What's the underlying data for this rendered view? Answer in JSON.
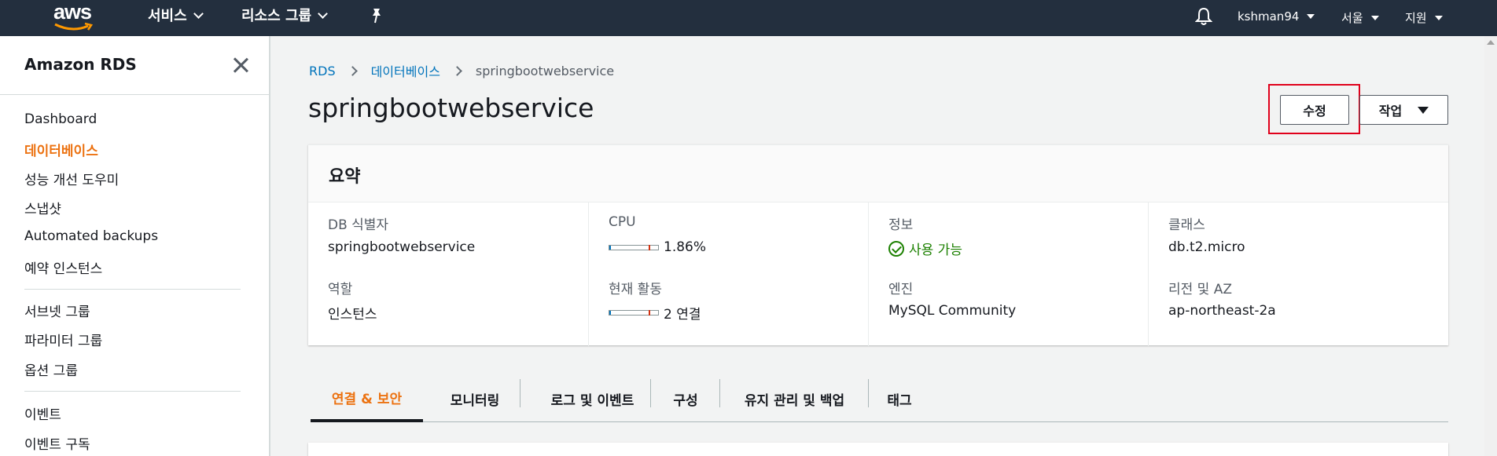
{
  "topnav": {
    "logo": "aws",
    "services": "서비스",
    "resource_groups": "리소스 그룹",
    "user": "kshman94",
    "region": "서울",
    "support": "지원"
  },
  "sidebar": {
    "title": "Amazon RDS",
    "items": [
      {
        "label": "Dashboard"
      },
      {
        "label": "데이터베이스"
      },
      {
        "label": "성능 개선 도우미"
      },
      {
        "label": "스냅샷"
      },
      {
        "label": "Automated backups"
      },
      {
        "label": "예약 인스턴스"
      },
      {
        "label": "서브넷 그룹"
      },
      {
        "label": "파라미터 그룹"
      },
      {
        "label": "옵션 그룹"
      },
      {
        "label": "이벤트"
      },
      {
        "label": "이벤트 구독"
      }
    ]
  },
  "breadcrumb": {
    "root": "RDS",
    "section": "데이터베이스",
    "current": "springbootwebservice"
  },
  "page": {
    "title": "springbootwebservice",
    "modify_button": "수정",
    "actions_button": "작업"
  },
  "summary": {
    "title": "요약",
    "db_id_label": "DB 식별자",
    "db_id_value": "springbootwebservice",
    "role_label": "역할",
    "role_value": "인스턴스",
    "cpu_label": "CPU",
    "cpu_value": "1.86%",
    "activity_label": "현재 활동",
    "activity_value": "2 연결",
    "status_label": "정보",
    "status_value": "사용 가능",
    "engine_label": "엔진",
    "engine_value": "MySQL Community",
    "class_label": "클래스",
    "class_value": "db.t2.micro",
    "region_label": "리전 및 AZ",
    "region_value": "ap-northeast-2a",
    "status_color": "#1d8102"
  },
  "tabs": [
    {
      "label": "연결 & 보안"
    },
    {
      "label": "모니터링"
    },
    {
      "label": "로그 및 이벤트"
    },
    {
      "label": "구성"
    },
    {
      "label": "유지 관리 및 백업"
    },
    {
      "label": "태그"
    }
  ],
  "colors": {
    "nav_bg": "#232f3e",
    "accent": "#ec7211",
    "link": "#0073bb",
    "highlight": "#e0001b"
  }
}
